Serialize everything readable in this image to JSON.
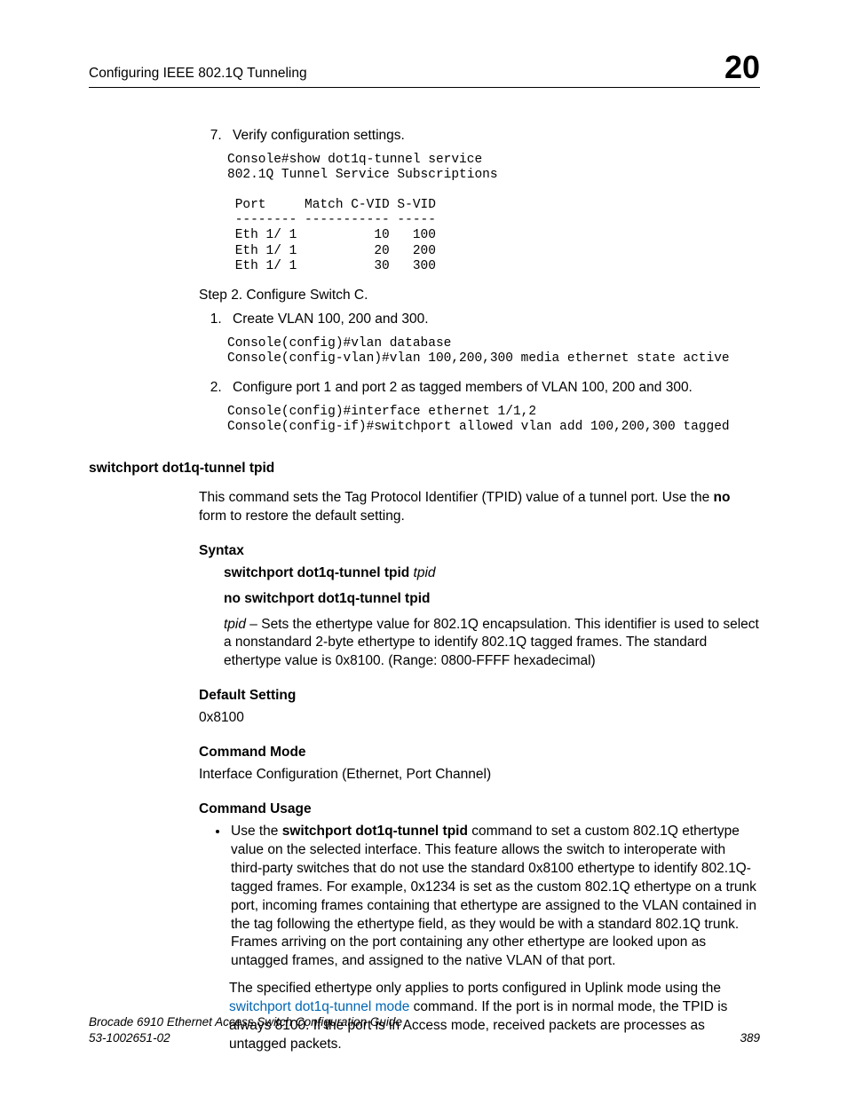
{
  "header": {
    "left": "Configuring IEEE 802.1Q Tunneling",
    "right": "20"
  },
  "top_list_start": 7,
  "top_list": {
    "item7": "Verify configuration settings."
  },
  "console1": "Console#show dot1q-tunnel service\n802.1Q Tunnel Service Subscriptions\n\n Port     Match C-VID S-VID\n -------- ----------- -----\n Eth 1/ 1          10   100\n Eth 1/ 1          20   200\n Eth 1/ 1          30   300",
  "step2_heading": "Step 2. Configure Switch C.",
  "step2_list": {
    "item1": "Create VLAN 100, 200 and 300.",
    "item2": "Configure port 1 and port 2 as tagged members of VLAN 100, 200 and 300."
  },
  "console2": "Console(config)#vlan database\nConsole(config-vlan)#vlan 100,200,300 media ethernet state active",
  "console3": "Console(config)#interface ethernet 1/1,2\nConsole(config-if)#switchport allowed vlan add 100,200,300 tagged",
  "cmd": {
    "title": "switchport dot1q-tunnel tpid",
    "desc_p1": "This command sets the Tag Protocol Identifier (TPID) value of a tunnel port. Use the ",
    "desc_bold": "no",
    "desc_p2": " form to restore the default setting.",
    "syntax_label": "Syntax",
    "syntax1_bold": "switchport dot1q-tunnel tpid ",
    "syntax1_italic": "tpid",
    "syntax2": "no switchport dot1q-tunnel tpid",
    "param_italic": "tpid",
    "param_rest": " – Sets the ethertype value for 802.1Q encapsulation. This identifier is used to select a nonstandard 2-byte ethertype to identify 802.1Q tagged frames. The standard ethertype value is 0x8100. (Range: 0800-FFFF hexadecimal)",
    "default_label": "Default Setting",
    "default_value": "0x8100",
    "mode_label": "Command Mode",
    "mode_value": "Interface Configuration (Ethernet, Port Channel)",
    "usage_label": "Command Usage",
    "usage1_p1": "Use the ",
    "usage1_bold": "switchport dot1q-tunnel tpid",
    "usage1_p2": " command to set a custom 802.1Q ethertype value on the selected interface. This feature allows the switch to interoperate with third-party switches that do not use the standard 0x8100 ethertype to identify 802.1Q-tagged frames. For example, 0x1234 is set as the custom 802.1Q ethertype on a trunk port, incoming frames containing that ethertype are assigned to the VLAN contained in the tag following the ethertype field, as they would be with a standard 802.1Q trunk. Frames arriving on the port containing any other ethertype are looked upon as untagged frames, and assigned to the native VLAN of that port.",
    "usage2_p1": "The specified ethertype only applies to ports configured in Uplink mode using the ",
    "usage2_link": "switchport dot1q-tunnel mode",
    "usage2_p2": " command. If the port is in normal mode, the TPID is always 8100. If the port is in Access mode, received packets are processes as untagged packets."
  },
  "footer": {
    "left1": "Brocade 6910 Ethernet Access Switch Configuration Guide",
    "left2": "53-1002651-02",
    "right": "389"
  }
}
